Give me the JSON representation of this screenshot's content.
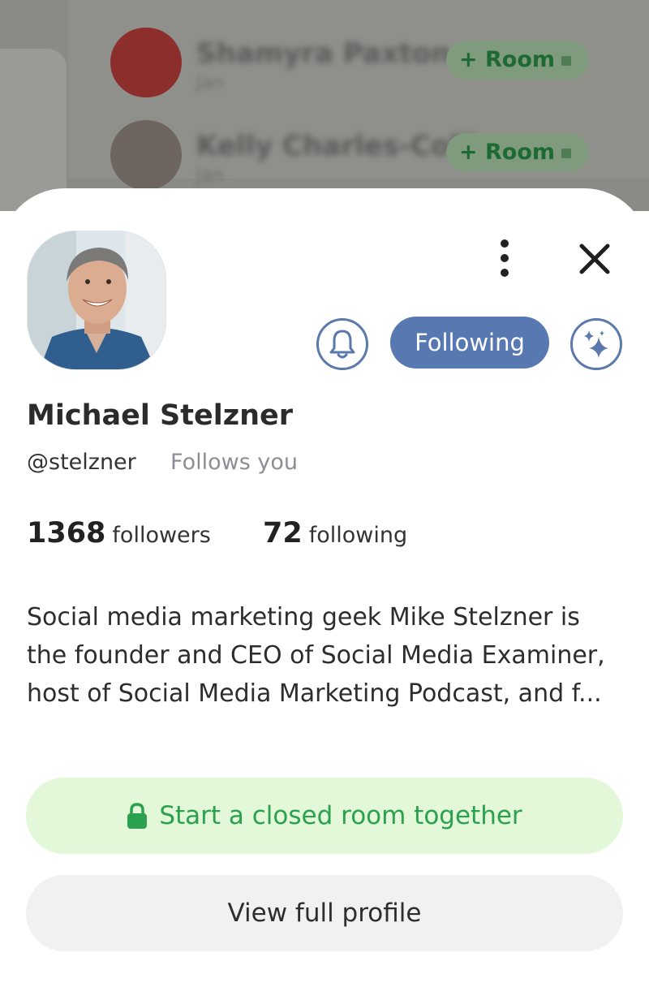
{
  "background": {
    "rows": [
      {
        "name": "Shamyra Paxton",
        "sub": "Jan",
        "room_button": "+ Room"
      },
      {
        "name": "Kelly Charles-Collins",
        "sub": "Jan",
        "room_button": "+ Room"
      }
    ]
  },
  "profile": {
    "name": "Michael Stelzner",
    "handle": "@stelzner",
    "follows_you": "Follows you",
    "followers_count": "1368",
    "followers_label": "followers",
    "following_count": "72",
    "following_label": "following",
    "bio": "Social media marketing geek Mike Stelzner is the founder and CEO of Social Media Examiner, host of Social Media Marketing Podcast, and f..."
  },
  "actions": {
    "following_label": "Following",
    "closed_room_label": "Start a closed room together",
    "view_profile_label": "View full profile"
  },
  "icons": {
    "more": "more-vertical-icon",
    "close": "close-icon",
    "bell": "bell-icon",
    "sparkle": "sparkle-icon",
    "lock": "lock-icon"
  },
  "colors": {
    "accent_blue": "#5878b1",
    "green_text": "#2ba04f",
    "green_bg": "#e2f8d8",
    "muted_text": "#8b8f95"
  }
}
